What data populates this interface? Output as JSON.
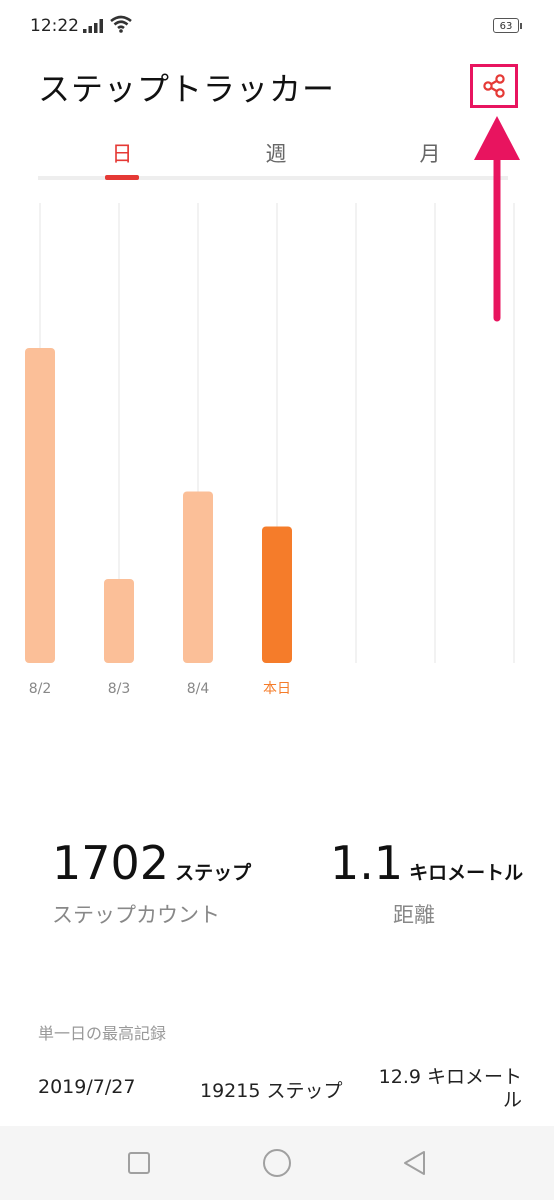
{
  "status_bar": {
    "time": "12:22",
    "battery": "63"
  },
  "header": {
    "title": "ステップトラッカー"
  },
  "tabs": [
    {
      "label": "日"
    },
    {
      "label": "週"
    },
    {
      "label": "月"
    }
  ],
  "colors": {
    "accent": "#e53935",
    "annotation": "#e8145f",
    "bar_light": "#fbbf98",
    "bar_today": "#f57c2a"
  },
  "icons": {
    "share": "share-icon",
    "signal": "signal-icon",
    "wifi": "wifi-icon",
    "battery": "battery-icon"
  },
  "chart_data": {
    "type": "bar",
    "categories": [
      "8/2",
      "8/3",
      "8/4",
      "本日"
    ],
    "values": [
      1800,
      480,
      980,
      780
    ],
    "highlight": "本日",
    "empty_slots_after": 3
  },
  "stats": {
    "steps": {
      "value": "1702",
      "unit": "ステップ",
      "label": "ステップカウント"
    },
    "distance": {
      "value": "1.1",
      "unit": "キロメートル",
      "label": "距離"
    }
  },
  "record": {
    "title": "単一日の最高記録",
    "date": "2019/7/27",
    "steps": "19215 ステップ",
    "distance": "12.9 キロメートル"
  }
}
